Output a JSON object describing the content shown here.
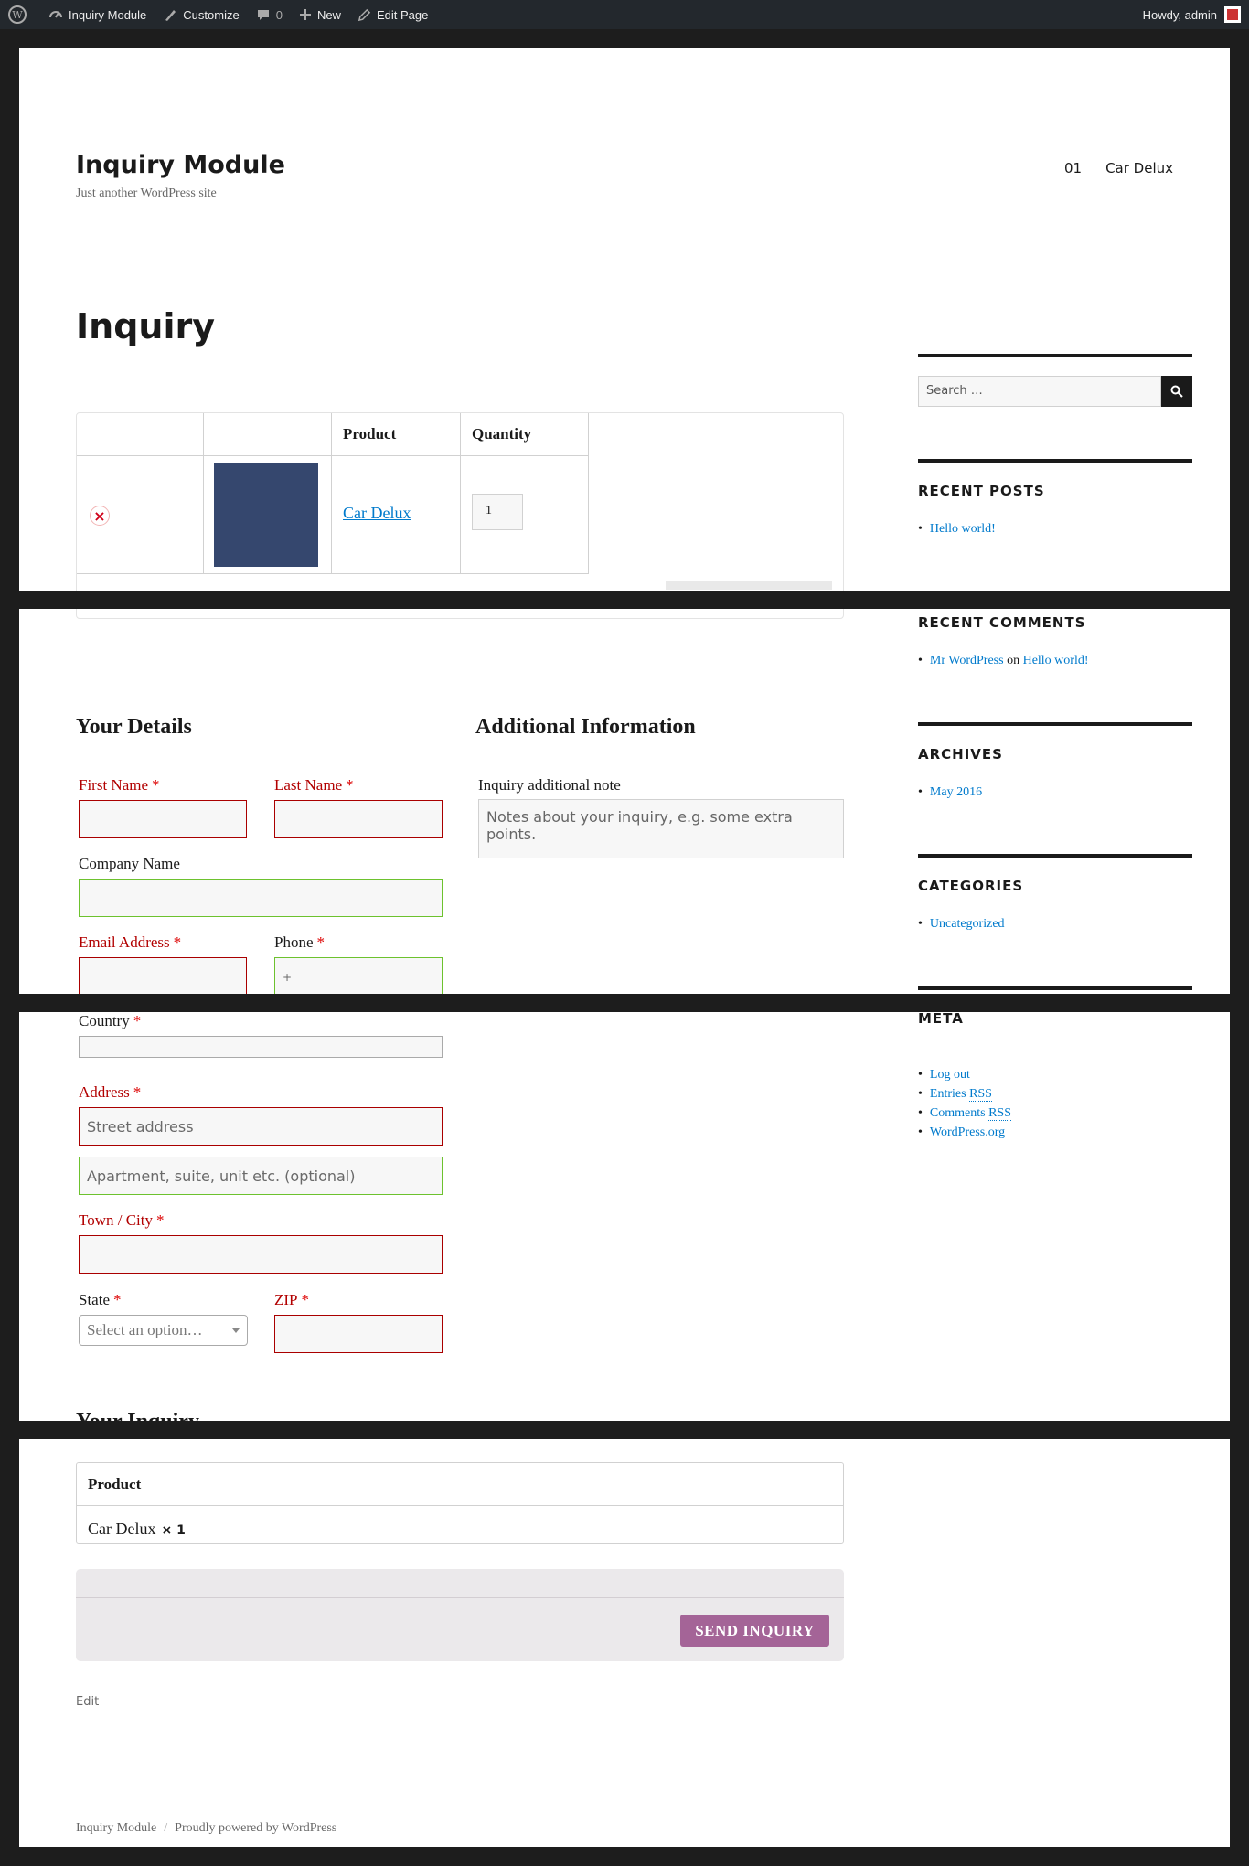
{
  "admin_bar": {
    "site_name": "Inquiry Module",
    "customize": "Customize",
    "comments_count": "0",
    "new": "New",
    "edit_page": "Edit Page",
    "howdy": "Howdy, admin"
  },
  "header": {
    "site_title": "Inquiry Module",
    "tagline": "Just another WordPress site",
    "nav": [
      "01",
      "Car Delux"
    ]
  },
  "page_title": "Inquiry",
  "cart": {
    "headers": [
      "",
      "",
      "Product",
      "Quantity"
    ],
    "item": {
      "name": "Car Delux",
      "quantity": "1",
      "thumb_color": "#35476e"
    }
  },
  "details": {
    "heading": "Your Details",
    "first_name": "First Name",
    "last_name": "Last Name",
    "company": "Company Name",
    "email": "Email Address",
    "phone": "Phone",
    "phone_value": "+",
    "country": "Country",
    "address": "Address",
    "street_placeholder": "Street address",
    "apartment_placeholder": "Apartment, suite, unit etc. (optional)",
    "city": "Town / City",
    "state": "State",
    "state_select": "Select an option…",
    "zip": "ZIP",
    "required_mark": "*"
  },
  "additional": {
    "heading": "Additional Information",
    "note_label": "Inquiry additional note",
    "note_placeholder": "Notes about your inquiry, e.g. some extra points."
  },
  "your_inquiry": {
    "heading": "Your Inquiry",
    "col_product": "Product",
    "item_name": "Car Delux",
    "item_qty": "× 1"
  },
  "submit": {
    "label": "SEND INQUIRY",
    "color": "#a46497"
  },
  "edit_link": "Edit",
  "footer": {
    "site": "Inquiry Module",
    "separator": "/",
    "powered": "Proudly powered by WordPress"
  },
  "sidebar": {
    "search_placeholder": "Search …",
    "recent_posts": {
      "title": "RECENT POSTS",
      "items": [
        "Hello world!"
      ]
    },
    "recent_comments": {
      "title": "RECENT COMMENTS",
      "author": "Mr WordPress",
      "on": "on",
      "post": "Hello world!"
    },
    "archives": {
      "title": "ARCHIVES",
      "items": [
        "May 2016"
      ]
    },
    "categories": {
      "title": "CATEGORIES",
      "items": [
        "Uncategorized"
      ]
    },
    "meta": {
      "title": "META",
      "log_out": "Log out",
      "entries": "Entries",
      "comments": "Comments",
      "rss": "RSS",
      "wordpress_org": "WordPress.org"
    }
  },
  "colors": {
    "link": "#007acc",
    "required": "#b20000",
    "valid_border": "#6dc22e"
  }
}
